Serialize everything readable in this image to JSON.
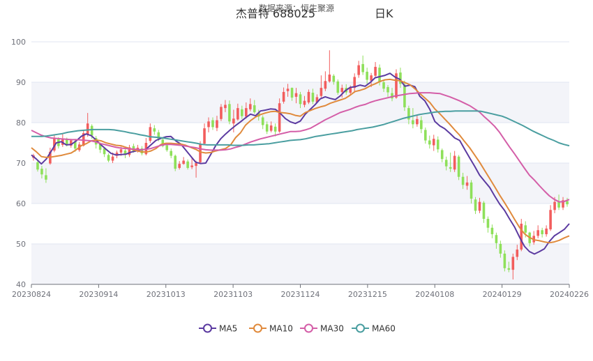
{
  "chart_data": {
    "type": "candlestick",
    "title": "杰普特 688025",
    "title_suffix": "日K",
    "source_text": "数据来源：恒生聚源",
    "ylim": [
      40,
      100
    ],
    "y_ticks": [
      40,
      50,
      60,
      70,
      80,
      90,
      100
    ],
    "grid": true,
    "legend_position": "bottom-center",
    "x_tick_labels": [
      "20230824",
      "20230914",
      "20231013",
      "20231103",
      "20231124",
      "20231215",
      "20240108",
      "20240129",
      "20240226"
    ],
    "up_color": "#f25d5d",
    "down_color": "#8ee05a",
    "band_color": "#f3f4f9",
    "series": [
      {
        "name": "MA5",
        "color": "#5b3aa0",
        "values": [
          72.0,
          71.0,
          69.8,
          71.0,
          73.0,
          75.0,
          75.3,
          74.5,
          74.6,
          75.5,
          76.6,
          77.2,
          76.8,
          75.7,
          74.5,
          73.4,
          72.4,
          72.0,
          72.1,
          72.2,
          72.7,
          73.0,
          73.3,
          73.4,
          74.5,
          75.6,
          76.1,
          76.5,
          76.6,
          75.5,
          74.7,
          73.2,
          71.7,
          70.2,
          69.9,
          70.0,
          72.1,
          74.3,
          76.0,
          77.2,
          78.3,
          79.3,
          80.2,
          81.2,
          82.1,
          81.7,
          82.9,
          83.1,
          83.4,
          83.3,
          82.3,
          81.0,
          80.2,
          79.8,
          80.4,
          82.1,
          83.3,
          84.5,
          85.9,
          86.4,
          86.0,
          85.7,
          86.6,
          87.9,
          88.7,
          88.9,
          89.3,
          89.0,
          89.9,
          91.1,
          91.4,
          91.7,
          92.2,
          91.3,
          90.7,
          89.0,
          89.3,
          88.9,
          86.5,
          85.4,
          83.3,
          80.3,
          79.2,
          78.5,
          77.4,
          76.2,
          75.6,
          73.4,
          71.3,
          69.2,
          67.0,
          65.5,
          64.0,
          61.9,
          59.9,
          58.3,
          56.2,
          54.2,
          51.7,
          49.4,
          48.1,
          47.5,
          48.1,
          48.8,
          50.6,
          52.0,
          52.8,
          53.6,
          55.0
        ]
      },
      {
        "name": "MA10",
        "color": "#e08a3c",
        "values": [
          73.8,
          72.8,
          71.6,
          71.4,
          71.5,
          71.7,
          71.9,
          72.2,
          72.5,
          73.3,
          74.3,
          74.8,
          75.5,
          75.7,
          75.5,
          75.0,
          74.7,
          74.4,
          74.3,
          73.9,
          73.5,
          73.1,
          72.8,
          72.7,
          73.0,
          73.6,
          74.6,
          74.9,
          74.9,
          74.8,
          74.7,
          74.4,
          73.9,
          73.4,
          72.7,
          72.5,
          72.6,
          73.0,
          73.3,
          73.6,
          74.5,
          76.3,
          77.5,
          79.4,
          80.5,
          81.4,
          82.0,
          82.4,
          82.7,
          82.8,
          82.5,
          82.4,
          82.2,
          81.8,
          81.6,
          82.5,
          83.0,
          83.5,
          83.9,
          84.2,
          84.8,
          85.2,
          85.6,
          86.0,
          86.8,
          87.7,
          88.0,
          88.4,
          89.1,
          89.6,
          90.2,
          90.6,
          90.7,
          90.5,
          90.4,
          89.9,
          89.4,
          88.4,
          87.2,
          86.1,
          85.0,
          83.4,
          82.2,
          80.9,
          79.6,
          78.2,
          76.9,
          75.3,
          73.8,
          72.0,
          70.2,
          68.2,
          66.2,
          64.2,
          62.1,
          60.2,
          58.2,
          56.1,
          54.1,
          52.5,
          51.6,
          51.0,
          50.8,
          50.5,
          50.3,
          50.5,
          50.9,
          51.5,
          52.0
        ]
      },
      {
        "name": "MA30",
        "color": "#d45ea8",
        "values": [
          78.1,
          77.5,
          76.9,
          76.5,
          76.2,
          76.1,
          76.0,
          75.9,
          75.8,
          75.8,
          75.7,
          75.6,
          75.5,
          75.2,
          74.8,
          74.5,
          74.2,
          73.9,
          73.7,
          73.6,
          73.5,
          73.4,
          73.3,
          73.4,
          73.6,
          74.0,
          74.4,
          74.6,
          74.6,
          74.5,
          74.4,
          74.2,
          74.0,
          73.8,
          73.5,
          73.3,
          73.2,
          73.2,
          73.2,
          73.3,
          73.5,
          73.9,
          74.2,
          74.7,
          75.2,
          75.6,
          76.0,
          76.3,
          76.6,
          76.9,
          77.2,
          77.5,
          77.8,
          77.8,
          77.9,
          78.2,
          78.6,
          79.3,
          80.0,
          80.7,
          81.3,
          81.9,
          82.5,
          82.9,
          83.3,
          83.8,
          84.2,
          84.5,
          85.0,
          85.4,
          85.7,
          86.0,
          86.3,
          86.6,
          86.8,
          87.0,
          87.2,
          87.3,
          87.4,
          87.4,
          87.4,
          87.3,
          87.2,
          86.8,
          86.4,
          85.9,
          85.4,
          84.8,
          84.2,
          83.4,
          82.6,
          81.4,
          80.3,
          79.1,
          77.6,
          75.8,
          74.0,
          72.3,
          70.5,
          68.7,
          67.0,
          65.8,
          64.4,
          63.1,
          61.9,
          61.0,
          60.4,
          60.5,
          61.0
        ]
      },
      {
        "name": "MA60",
        "color": "#4a9ea0",
        "values": [
          76.6,
          76.6,
          76.6,
          76.7,
          76.9,
          77.1,
          77.3,
          77.6,
          77.8,
          78.0,
          78.1,
          78.2,
          78.3,
          78.3,
          78.3,
          78.3,
          78.2,
          78.0,
          77.8,
          77.5,
          77.3,
          77.0,
          76.8,
          76.5,
          76.4,
          76.3,
          76.1,
          75.9,
          75.7,
          75.5,
          75.3,
          75.1,
          74.9,
          74.6,
          74.5,
          74.5,
          74.5,
          74.5,
          74.5,
          74.4,
          74.4,
          74.4,
          74.5,
          74.5,
          74.6,
          74.7,
          74.8,
          75.0,
          75.2,
          75.4,
          75.6,
          75.7,
          75.8,
          76.0,
          76.3,
          76.6,
          76.8,
          77.0,
          77.2,
          77.4,
          77.6,
          77.8,
          78.0,
          78.3,
          78.5,
          78.7,
          78.9,
          79.2,
          79.5,
          79.9,
          80.3,
          80.7,
          81.1,
          81.4,
          81.7,
          82.0,
          82.2,
          82.4,
          82.6,
          82.7,
          82.8,
          82.8,
          82.9,
          82.9,
          82.9,
          82.9,
          82.9,
          82.8,
          82.5,
          82.2,
          81.9,
          81.6,
          81.1,
          80.5,
          79.9,
          79.3,
          78.6,
          77.9,
          77.3,
          76.7,
          76.1,
          75.6,
          75.0,
          74.6,
          74.3
        ]
      }
    ],
    "candles": [
      [
        71.3,
        71.9,
        72.3,
        70.6
      ],
      [
        70.2,
        68.4,
        70.5,
        67.9
      ],
      [
        68.6,
        67.2,
        69.3,
        66.2
      ],
      [
        67.0,
        65.9,
        68.7,
        65.1
      ],
      [
        69.9,
        72.8,
        73.8,
        69.6
      ],
      [
        73.1,
        76.2,
        76.9,
        72.7
      ],
      [
        75.9,
        74.2,
        76.4,
        73.6
      ],
      [
        74.5,
        76.0,
        77.2,
        74.0
      ],
      [
        75.8,
        74.7,
        76.3,
        74.1
      ],
      [
        74.3,
        75.6,
        76.0,
        73.8
      ],
      [
        75.4,
        73.6,
        76.0,
        72.8
      ],
      [
        73.2,
        74.6,
        75.2,
        72.8
      ],
      [
        74.3,
        77.4,
        78.1,
        74.1
      ],
      [
        77.0,
        79.8,
        82.4,
        76.5
      ],
      [
        79.2,
        76.8,
        79.6,
        76.0
      ],
      [
        76.2,
        74.6,
        76.7,
        73.6
      ],
      [
        74.9,
        73.3,
        75.1,
        72.5
      ],
      [
        73.6,
        72.2,
        74.0,
        71.5
      ],
      [
        72.0,
        70.6,
        72.4,
        70.2
      ],
      [
        70.6,
        71.6,
        72.6,
        70.0
      ],
      [
        71.8,
        72.6,
        73.1,
        71.2
      ],
      [
        72.6,
        73.4,
        74.1,
        71.8
      ],
      [
        73.1,
        72.3,
        73.7,
        71.2
      ],
      [
        72.0,
        73.9,
        74.5,
        71.5
      ],
      [
        74.2,
        73.0,
        74.8,
        72.6
      ],
      [
        73.0,
        73.8,
        74.5,
        72.6
      ],
      [
        73.6,
        72.4,
        74.2,
        71.9
      ],
      [
        72.2,
        75.0,
        76.2,
        71.9
      ],
      [
        75.5,
        78.9,
        79.8,
        75.0
      ],
      [
        78.6,
        77.8,
        79.4,
        77.0
      ],
      [
        77.6,
        76.0,
        78.2,
        75.4
      ],
      [
        75.8,
        74.2,
        76.3,
        73.9
      ],
      [
        74.4,
        73.2,
        75.0,
        72.8
      ],
      [
        73.0,
        71.8,
        73.6,
        71.2
      ],
      [
        71.8,
        68.6,
        72.1,
        68.0
      ],
      [
        68.8,
        69.8,
        70.5,
        68.4
      ],
      [
        69.8,
        70.6,
        71.5,
        69.6
      ],
      [
        70.4,
        68.8,
        70.9,
        68.4
      ],
      [
        69.0,
        69.4,
        71.2,
        68.5
      ],
      [
        69.3,
        70.0,
        70.6,
        66.4
      ],
      [
        70.2,
        74.6,
        75.4,
        69.8
      ],
      [
        74.8,
        78.6,
        79.8,
        74.6
      ],
      [
        78.9,
        80.3,
        81.3,
        77.6
      ],
      [
        80.6,
        78.9,
        81.3,
        78.2
      ],
      [
        78.7,
        80.6,
        81.7,
        77.9
      ],
      [
        80.9,
        83.9,
        84.6,
        80.4
      ],
      [
        83.6,
        84.4,
        85.6,
        82.6
      ],
      [
        84.6,
        80.3,
        85.5,
        79.6
      ],
      [
        79.8,
        81.0,
        83.2,
        77.6
      ],
      [
        80.8,
        83.6,
        84.7,
        80.5
      ],
      [
        83.3,
        81.6,
        84.2,
        80.9
      ],
      [
        81.5,
        83.6,
        85.0,
        81.0
      ],
      [
        83.3,
        84.6,
        86.0,
        82.8
      ],
      [
        84.3,
        82.6,
        85.6,
        82.2
      ],
      [
        82.4,
        81.5,
        83.2,
        80.5
      ],
      [
        81.3,
        79.4,
        81.8,
        78.4
      ],
      [
        79.6,
        77.8,
        80.3,
        77.2
      ],
      [
        78.0,
        79.3,
        80.3,
        77.6
      ],
      [
        79.0,
        77.8,
        79.8,
        76.6
      ],
      [
        77.8,
        84.8,
        86.0,
        77.5
      ],
      [
        85.2,
        87.6,
        88.7,
        84.7
      ],
      [
        87.8,
        88.4,
        89.6,
        86.4
      ],
      [
        88.6,
        86.2,
        88.7,
        85.4
      ],
      [
        86.4,
        87.3,
        88.6,
        84.8
      ],
      [
        87.0,
        84.6,
        87.6,
        83.6
      ],
      [
        84.4,
        85.4,
        86.6,
        83.8
      ],
      [
        85.0,
        87.6,
        88.2,
        84.6
      ],
      [
        87.4,
        85.2,
        88.4,
        84.6
      ],
      [
        85.0,
        86.3,
        87.0,
        84.8
      ],
      [
        86.6,
        88.6,
        91.7,
        86.2
      ],
      [
        88.4,
        90.3,
        92.7,
        87.8
      ],
      [
        90.2,
        91.9,
        97.9,
        89.9
      ],
      [
        91.6,
        90.1,
        92.0,
        89.4
      ],
      [
        90.2,
        87.4,
        90.7,
        86.9
      ],
      [
        87.6,
        88.6,
        89.4,
        86.2
      ],
      [
        88.6,
        87.5,
        89.5,
        86.9
      ],
      [
        87.4,
        88.7,
        89.2,
        86.9
      ],
      [
        88.6,
        91.3,
        92.2,
        87.4
      ],
      [
        91.8,
        94.2,
        95.3,
        91.1
      ],
      [
        94.5,
        92.5,
        96.6,
        91.8
      ],
      [
        92.6,
        90.6,
        93.6,
        89.6
      ],
      [
        90.4,
        91.7,
        92.3,
        88.8
      ],
      [
        91.6,
        93.8,
        95.0,
        91.3
      ],
      [
        93.6,
        90.0,
        94.4,
        89.2
      ],
      [
        90.0,
        88.4,
        90.6,
        87.6
      ],
      [
        88.8,
        87.5,
        89.3,
        86.4
      ],
      [
        87.3,
        86.0,
        88.6,
        85.3
      ],
      [
        86.2,
        92.2,
        93.2,
        85.9
      ],
      [
        92.4,
        89.6,
        93.6,
        88.6
      ],
      [
        89.4,
        83.8,
        90.4,
        82.9
      ],
      [
        83.6,
        80.8,
        84.2,
        79.6
      ],
      [
        80.6,
        79.6,
        83.6,
        78.6
      ],
      [
        79.6,
        80.9,
        82.0,
        79.0
      ],
      [
        80.6,
        78.4,
        81.6,
        77.4
      ],
      [
        78.2,
        75.6,
        78.8,
        74.8
      ],
      [
        75.6,
        74.6,
        76.8,
        73.6
      ],
      [
        74.4,
        76.0,
        77.0,
        73.0
      ],
      [
        75.8,
        73.4,
        76.6,
        72.6
      ],
      [
        73.2,
        71.0,
        73.6,
        70.2
      ],
      [
        70.8,
        69.2,
        71.6,
        68.2
      ],
      [
        69.0,
        68.6,
        72.6,
        67.8
      ],
      [
        68.4,
        71.8,
        73.0,
        67.8
      ],
      [
        71.6,
        66.6,
        72.0,
        65.8
      ],
      [
        66.6,
        64.6,
        67.6,
        63.6
      ],
      [
        64.4,
        65.2,
        66.8,
        63.4
      ],
      [
        65.2,
        61.2,
        65.8,
        60.0
      ],
      [
        61.0,
        58.2,
        61.6,
        57.4
      ],
      [
        58.2,
        60.4,
        61.4,
        57.6
      ],
      [
        60.2,
        56.2,
        60.6,
        55.2
      ],
      [
        56.2,
        54.0,
        56.8,
        52.8
      ],
      [
        54.0,
        52.4,
        54.8,
        51.4
      ],
      [
        52.2,
        50.2,
        52.8,
        48.8
      ],
      [
        50.0,
        47.6,
        50.8,
        46.6
      ],
      [
        47.6,
        44.0,
        48.4,
        43.2
      ],
      [
        44.0,
        43.6,
        45.6,
        43.0
      ],
      [
        43.6,
        46.8,
        47.6,
        41.2
      ],
      [
        46.8,
        48.6,
        49.8,
        46.0
      ],
      [
        48.6,
        55.0,
        56.2,
        48.2
      ],
      [
        54.6,
        52.8,
        55.6,
        51.6
      ],
      [
        52.8,
        50.2,
        53.0,
        49.4
      ],
      [
        50.4,
        52.0,
        53.2,
        49.8
      ],
      [
        52.0,
        53.4,
        54.6,
        51.4
      ],
      [
        53.4,
        52.4,
        54.0,
        51.6
      ],
      [
        52.4,
        53.8,
        54.6,
        51.8
      ],
      [
        53.6,
        58.4,
        59.6,
        53.2
      ],
      [
        58.4,
        60.4,
        61.6,
        57.6
      ],
      [
        60.4,
        59.0,
        62.2,
        58.4
      ],
      [
        59.0,
        60.8,
        61.6,
        58.4
      ],
      [
        60.6,
        59.8,
        61.4,
        59.2
      ]
    ]
  }
}
